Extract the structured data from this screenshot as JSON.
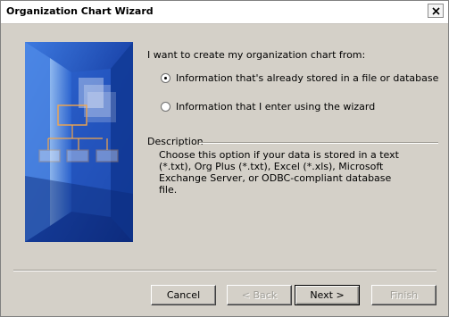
{
  "window": {
    "title": "Organization Chart Wizard"
  },
  "heading": "I want to create my organization chart from:",
  "options": [
    {
      "label": "Information that's already stored in a file or database",
      "selected": true
    },
    {
      "label": "Information that I enter using the wizard",
      "selected": false
    }
  ],
  "description": {
    "title": "Description",
    "text": "Choose this option if your data is stored in a text (*.txt), Org Plus (*.txt), Excel (*.xls), Microsoft Exchange Server, or ODBC-compliant database file."
  },
  "buttons": {
    "cancel": "Cancel",
    "back": "< Back",
    "next": "Next >",
    "finish": "Finish"
  },
  "colors": {
    "dialog_bg": "#d4d0c8",
    "art_blue": "#1f4fb8",
    "org_box_border": "#f4a64a"
  }
}
